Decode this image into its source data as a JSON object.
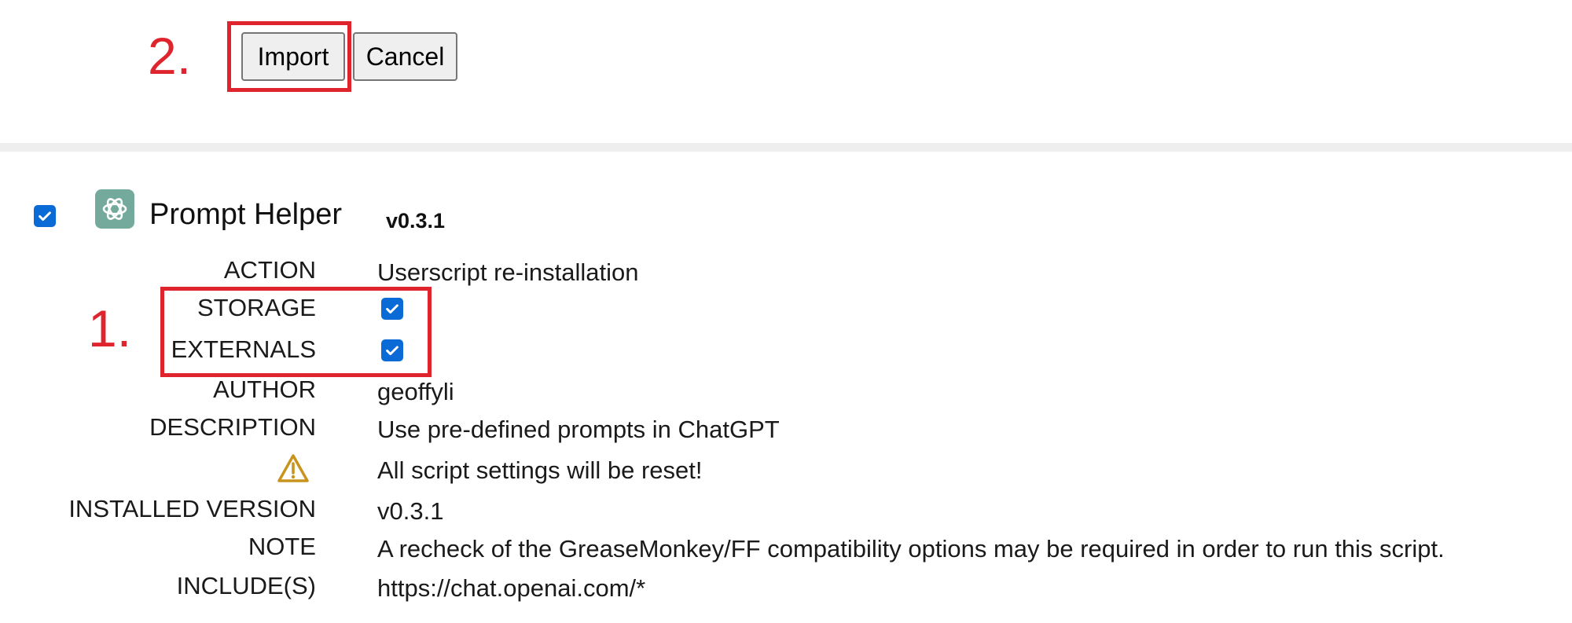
{
  "annotations": {
    "step1": "1.",
    "step2": "2.",
    "color": "#e0242e"
  },
  "buttons": {
    "import_label": "Import",
    "cancel_label": "Cancel"
  },
  "script": {
    "enabled": true,
    "icon": "chatgpt-logo-icon",
    "name": "Prompt Helper",
    "version": "v0.3.1"
  },
  "details": {
    "action": {
      "label": "ACTION",
      "value": "Userscript re-installation"
    },
    "storage": {
      "label": "STORAGE",
      "checked": true
    },
    "externals": {
      "label": "EXTERNALS",
      "checked": true
    },
    "author": {
      "label": "AUTHOR",
      "value": "geoffyli"
    },
    "description": {
      "label": "DESCRIPTION",
      "value": "Use pre-defined prompts in ChatGPT"
    },
    "warning": {
      "icon": "warning-icon",
      "value": "All script settings will be reset!"
    },
    "installed_version": {
      "label": "INSTALLED VERSION",
      "value": "v0.3.1"
    },
    "note": {
      "label": "NOTE",
      "value": "A recheck of the GreaseMonkey/FF compatibility options may be required in order to run this script."
    },
    "includes": {
      "label": "INCLUDE(S)",
      "value": "https://chat.openai.com/*"
    }
  },
  "colors": {
    "accent": "#0b6bd6",
    "warning": "#c8941e",
    "icon_bg": "#74aa9c"
  }
}
